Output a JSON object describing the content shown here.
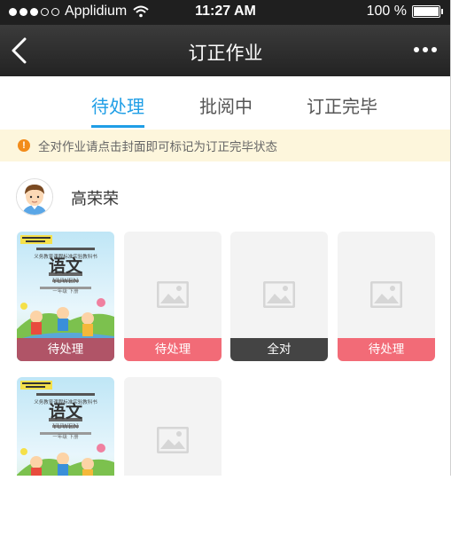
{
  "status_bar": {
    "carrier": "Applidium",
    "time": "11:27 AM",
    "battery": "100 %"
  },
  "nav": {
    "title": "订正作业",
    "back_icon": "chevron-left-icon",
    "more_icon": "more-dots-icon"
  },
  "tabs": [
    {
      "label": "待处理",
      "active": true
    },
    {
      "label": "批阅中",
      "active": false
    },
    {
      "label": "订正完毕",
      "active": false
    }
  ],
  "notice": {
    "icon": "exclamation-icon",
    "text": "全对作业请点击封面即可标记为订正完毕状态"
  },
  "student": {
    "name": "高荣荣",
    "avatar_icon": "boy-avatar-icon"
  },
  "cover": {
    "series": "义务教育课程标准实验教科书",
    "title": "语文",
    "subtitle": "YUWEN",
    "grade": "一年级 下册"
  },
  "cards": [
    {
      "type": "cover",
      "status": "待处理"
    },
    {
      "type": "placeholder",
      "status": "待处理"
    },
    {
      "type": "placeholder",
      "status": "全对"
    },
    {
      "type": "placeholder",
      "status": "待处理"
    },
    {
      "type": "cover",
      "status": ""
    },
    {
      "type": "placeholder",
      "status": ""
    }
  ],
  "colors": {
    "accent": "#1f9ee6",
    "pending": "#f26b77",
    "all_correct": "#444444",
    "notice_bg": "#fdf6dc",
    "notice_icon": "#f28c1b"
  }
}
